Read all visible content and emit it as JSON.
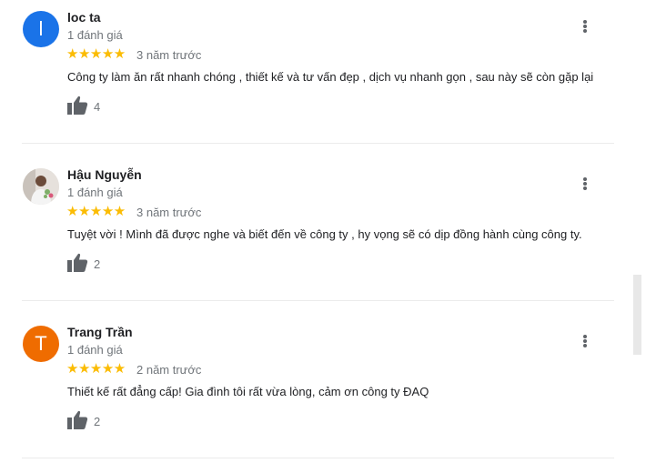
{
  "reviews": [
    {
      "avatar_letter": "l",
      "avatar_color": "#1a73e8",
      "name": "loc ta",
      "review_count": "1 đánh giá",
      "stars": "★★★★★",
      "time": "3 năm trước",
      "text": "Công ty làm ăn  rất nhanh chóng , thiết kế và tư vấn đẹp , dịch vụ nhanh gọn , sau này sẽ còn gặp lại",
      "likes": "4"
    },
    {
      "avatar_letter": "",
      "avatar_color": "#e8e3de",
      "name": "Hậu Nguyễn",
      "review_count": "1 đánh giá",
      "stars": "★★★★★",
      "time": "3 năm trước",
      "text": "Tuyệt vời ! Mình đã được nghe và biết đến về công ty ,  hy vọng sẽ có dịp đồng hành cùng công ty.",
      "likes": "2"
    },
    {
      "avatar_letter": "T",
      "avatar_color": "#ef6c00",
      "name": "Trang Trần",
      "review_count": "1 đánh giá",
      "stars": "★★★★★",
      "time": "2 năm trước",
      "text": "Thiết kế rất đẳng cấp! Gia đình tôi rất vừa lòng, cảm ơn công ty ĐAQ",
      "likes": "2"
    }
  ],
  "star_color": "#fbbc04",
  "icons": [
    "thumbs-up-icon",
    "more-vertical-icon"
  ]
}
